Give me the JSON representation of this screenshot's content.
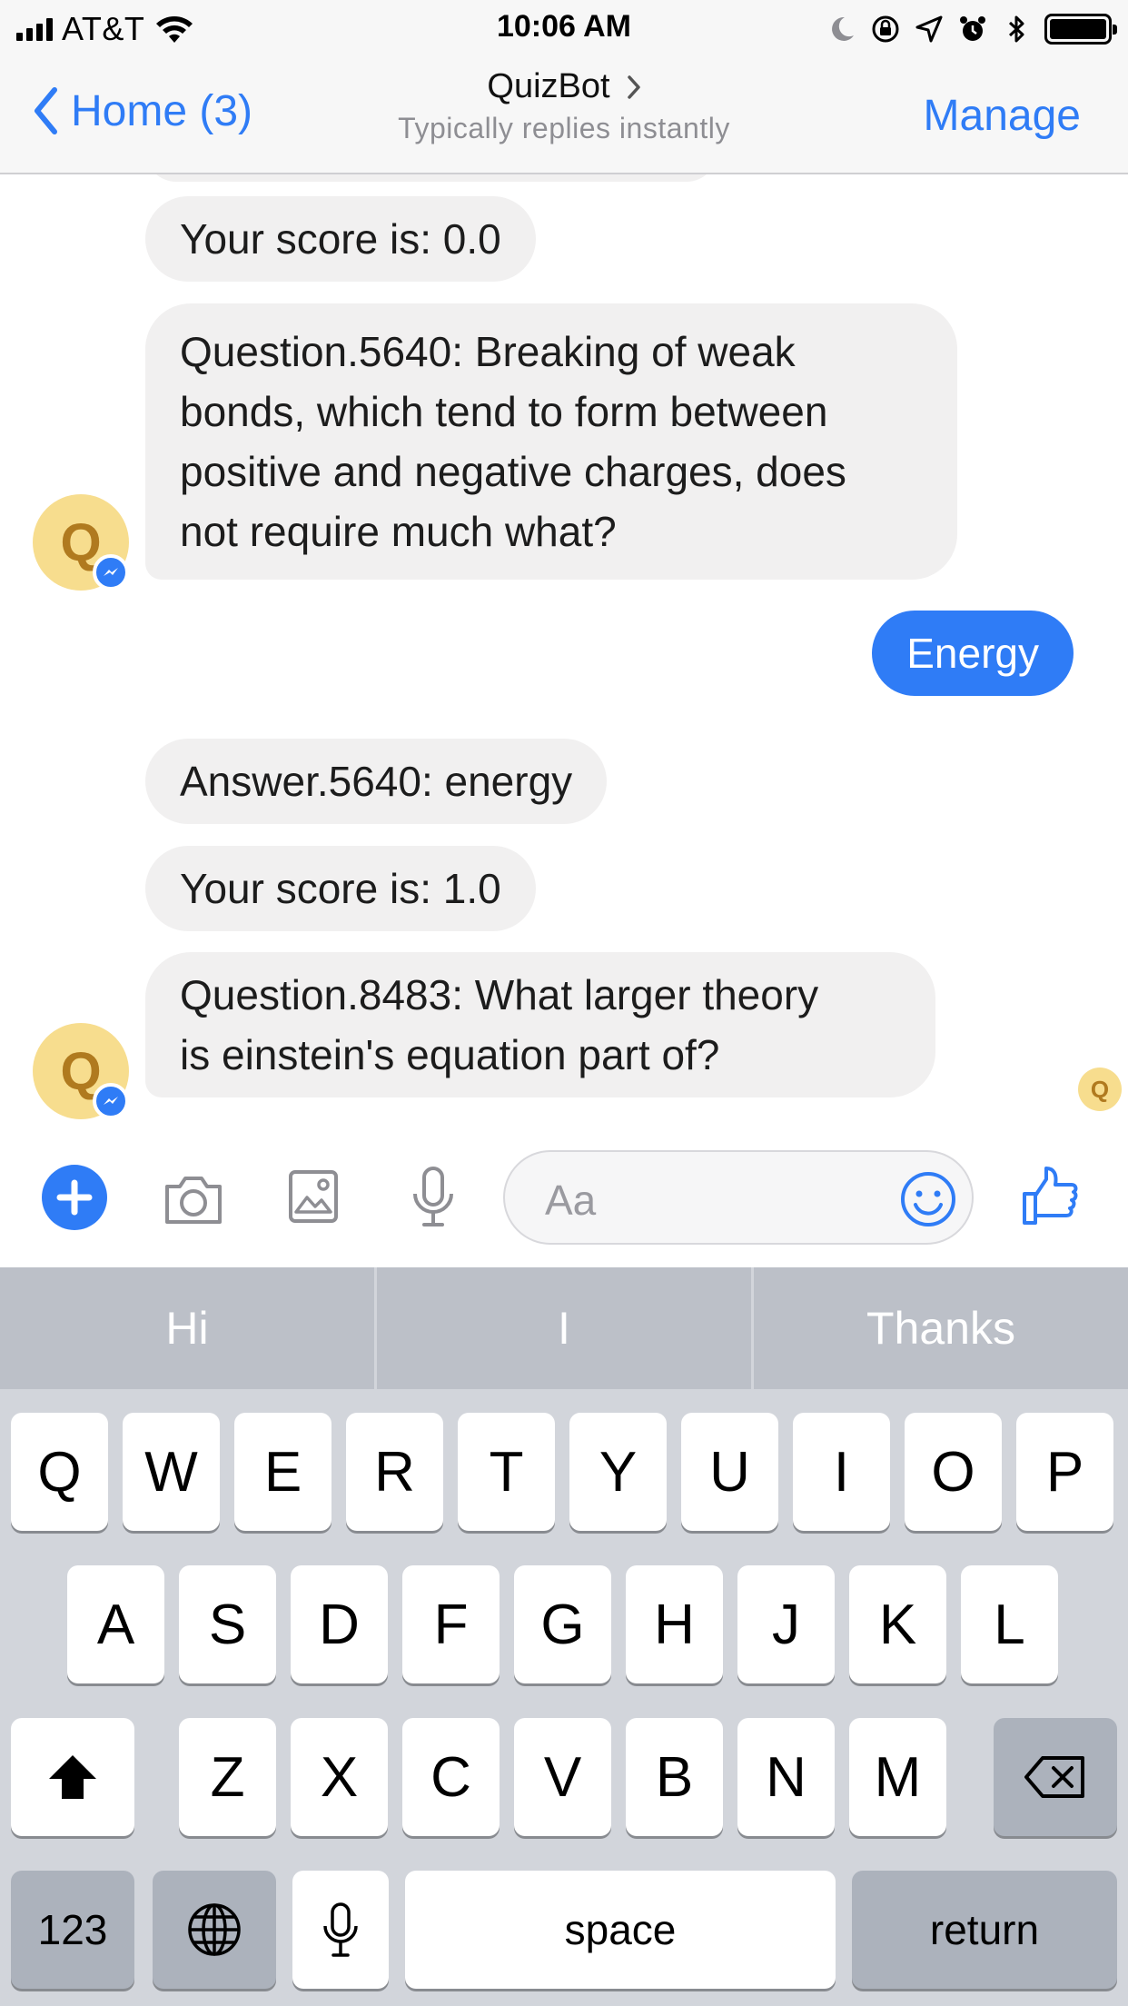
{
  "status_bar": {
    "carrier": "AT&T",
    "time": "10:06 AM",
    "icons": [
      "signal-icon",
      "wifi-icon",
      "moon-icon",
      "rotation-lock-icon",
      "location-icon",
      "alarm-icon",
      "bluetooth-icon",
      "battery-icon"
    ]
  },
  "nav": {
    "back_label": "Home (3)",
    "title": "QuizBot",
    "subtitle": "Typically replies instantly",
    "manage_label": "Manage"
  },
  "chat": {
    "bot_initial": "Q",
    "messages": [
      {
        "sender": "bot",
        "text": "Your score is: 0.0"
      },
      {
        "sender": "bot",
        "lines": [
          "Question.5640: Breaking of weak",
          "bonds, which tend to form between",
          "positive and negative charges, does",
          "not require much what?"
        ]
      },
      {
        "sender": "user",
        "text": "Energy"
      },
      {
        "sender": "bot",
        "text": "Answer.5640: energy"
      },
      {
        "sender": "bot",
        "text": "Your score is: 1.0"
      },
      {
        "sender": "bot",
        "lines": [
          "Question.8483: What larger theory",
          "is einstein's equation part of?"
        ]
      }
    ],
    "seen_initial": "Q"
  },
  "composer": {
    "placeholder": "Aa",
    "icons": [
      "plus-icon",
      "camera-icon",
      "image-icon",
      "microphone-icon",
      "emoji-icon",
      "thumbs-up-icon"
    ]
  },
  "keyboard": {
    "suggestions": [
      "Hi",
      "I",
      "Thanks"
    ],
    "row1": [
      "Q",
      "W",
      "E",
      "R",
      "T",
      "Y",
      "U",
      "I",
      "O",
      "P"
    ],
    "row2": [
      "A",
      "S",
      "D",
      "F",
      "G",
      "H",
      "J",
      "K",
      "L"
    ],
    "row3": [
      "Z",
      "X",
      "C",
      "V",
      "B",
      "N",
      "M"
    ],
    "numbers_label": "123",
    "space_label": "space",
    "return_label": "return"
  },
  "colors": {
    "accent": "#2f7cf6",
    "bubble_bot": "#f1f0f0",
    "avatar_bg": "#f7dd8e",
    "keyboard_bg": "#d2d5db"
  }
}
